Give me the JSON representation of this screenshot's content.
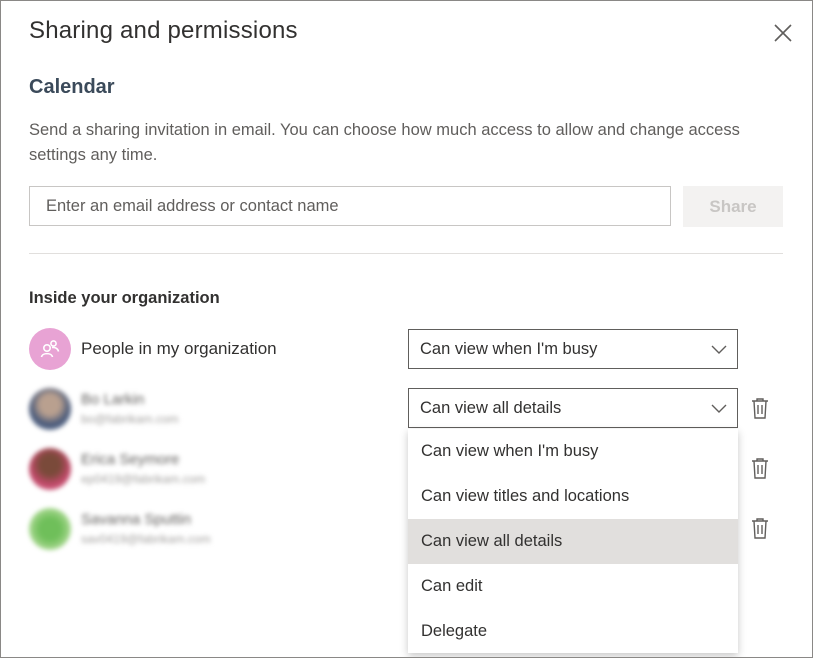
{
  "dialog": {
    "title": "Sharing and permissions",
    "close_icon": "close-icon"
  },
  "calendar": {
    "name": "Calendar",
    "description": "Send a sharing invitation in email. You can choose how much access to allow and change access settings any time.",
    "input_placeholder": "Enter an email address or contact name",
    "input_value": "",
    "share_label": "Share"
  },
  "organization": {
    "heading": "Inside your organization",
    "org_entry": {
      "name": "People in my organization",
      "permission": "Can view when I'm busy",
      "icon": "people-group-icon",
      "avatar_color": "#e8a3d4"
    },
    "people": [
      {
        "name": "Bo Larkin",
        "email": "bo@fabrikam.com",
        "permission": "Can view all details"
      },
      {
        "name": "Erica Seymore",
        "email": "ep0419@fabrikam.com",
        "permission": ""
      },
      {
        "name": "Savanna Sputtin",
        "email": "sav0419@fabrikam.com",
        "permission": ""
      }
    ]
  },
  "dropdown": {
    "options": [
      "Can view when I'm busy",
      "Can view titles and locations",
      "Can view all details",
      "Can edit",
      "Delegate"
    ],
    "selected": "Can view all details",
    "highlight_color": "#e1dfdd"
  }
}
